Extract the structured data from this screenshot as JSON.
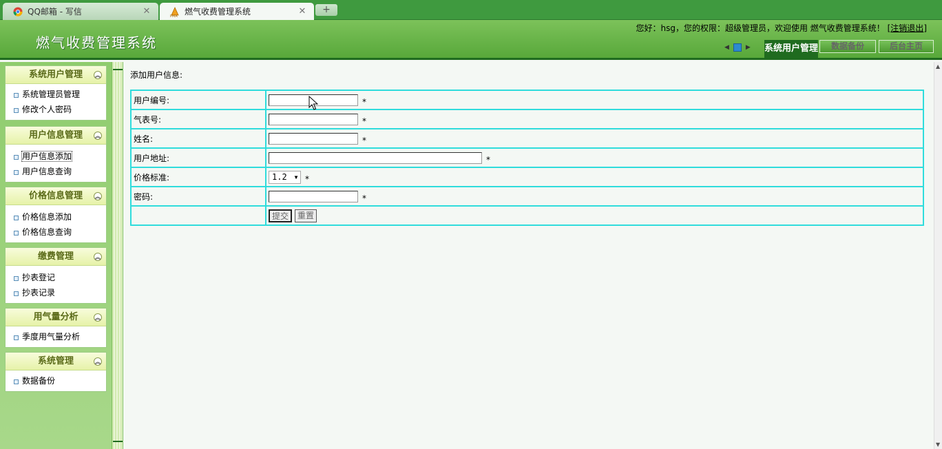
{
  "browser": {
    "tabs": [
      {
        "title": "QQ邮箱 - 写信",
        "icon": "chrome-icon",
        "active": false
      },
      {
        "title": "燃气收费管理系统",
        "icon": "pma-icon",
        "active": true
      }
    ],
    "new_tab_label": "+"
  },
  "header": {
    "title": "燃气收费管理系统",
    "welcome_text": "您好：hsg，您的权限：超级管理员，欢迎使用 燃气收费管理系统！ [",
    "logout_label": "注销退出",
    "welcome_close": "]",
    "tabs": [
      {
        "label": "系统用户管理",
        "active": true
      },
      {
        "label": "数据备份",
        "active": false
      },
      {
        "label": "后台主页",
        "active": false
      }
    ]
  },
  "sidebar": {
    "panels": [
      {
        "title": "系统用户管理",
        "items": [
          "系统管理员管理",
          "修改个人密码"
        ]
      },
      {
        "title": "用户信息管理",
        "items": [
          "用户信息添加",
          "用户信息查询"
        ]
      },
      {
        "title": "价格信息管理",
        "items": [
          "价格信息添加",
          "价格信息查询"
        ]
      },
      {
        "title": "缴费管理",
        "items": [
          "抄表登记",
          "抄表记录"
        ]
      },
      {
        "title": "用气量分析",
        "items": [
          "季度用气量分析"
        ]
      },
      {
        "title": "系统管理",
        "items": [
          "数据备份"
        ]
      }
    ],
    "toggle_icon": "collapse-up-icon"
  },
  "main": {
    "section_title": "添加用户信息:",
    "form": {
      "rows": [
        {
          "label": "用户编号:",
          "value": "",
          "required_mark": "*"
        },
        {
          "label": "气表号:",
          "value": "",
          "required_mark": "*"
        },
        {
          "label": "姓名:",
          "value": "",
          "required_mark": "*"
        },
        {
          "label": "用户地址:",
          "value": "",
          "required_mark": "*"
        },
        {
          "label": "价格标准:",
          "value": "1.2",
          "required_mark": "*"
        },
        {
          "label": "密码:",
          "value": "",
          "required_mark": "*"
        }
      ],
      "submit_label": "提交",
      "reset_label": "重置"
    }
  },
  "colors": {
    "header_green": "#58a83a",
    "dark_green": "#1f6b1f",
    "table_border": "#2fdcdc"
  }
}
